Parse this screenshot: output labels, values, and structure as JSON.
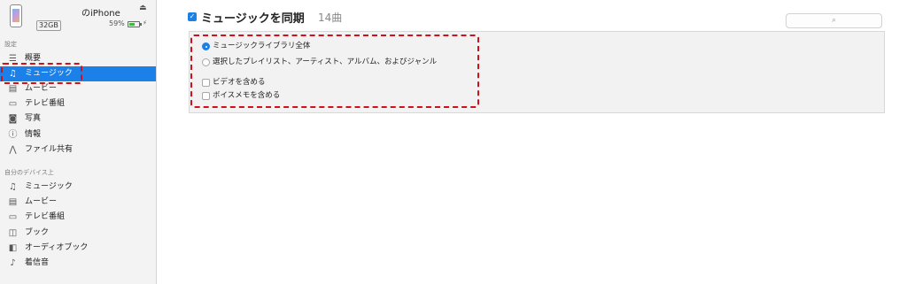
{
  "device": {
    "name": "のiPhone",
    "capacity": "32GB",
    "battery_percent": "59%",
    "battery_level": 0.59,
    "eject_icon": "eject-icon",
    "charging_icon": "charging-icon"
  },
  "sidebar": {
    "settings_label": "設定",
    "settings_items": [
      {
        "label": "概要",
        "icon": "summary-icon",
        "selected": false
      },
      {
        "label": "ミュージック",
        "icon": "music-note-icon",
        "selected": true
      },
      {
        "label": "ムービー",
        "icon": "film-icon",
        "selected": false
      },
      {
        "label": "テレビ番組",
        "icon": "tv-icon",
        "selected": false
      },
      {
        "label": "写真",
        "icon": "camera-icon",
        "selected": false
      },
      {
        "label": "情報",
        "icon": "info-icon",
        "selected": false
      },
      {
        "label": "ファイル共有",
        "icon": "file-sharing-icon",
        "selected": false
      }
    ],
    "on_device_label": "自分のデバイス上",
    "device_items": [
      {
        "label": "ミュージック",
        "icon": "music-note-icon"
      },
      {
        "label": "ムービー",
        "icon": "film-icon"
      },
      {
        "label": "テレビ番組",
        "icon": "tv-icon"
      },
      {
        "label": "ブック",
        "icon": "book-icon"
      },
      {
        "label": "オーディオブック",
        "icon": "audiobook-icon"
      },
      {
        "label": "着信音",
        "icon": "bell-icon"
      }
    ]
  },
  "main": {
    "sync_checked": true,
    "sync_title": "ミュージックを同期",
    "sync_count": "14曲",
    "search_icon": "search-icon",
    "options": [
      {
        "type": "radio",
        "label": "ミュージックライブラリ全体",
        "checked": true
      },
      {
        "type": "radio",
        "label": "選択したプレイリスト、アーティスト、アルバム、およびジャンル",
        "checked": false
      },
      {
        "type": "checkbox",
        "label": "ビデオを含める",
        "checked": false
      },
      {
        "type": "checkbox",
        "label": "ボイスメモを含める",
        "checked": false
      }
    ]
  },
  "colors": {
    "accent": "#1b81e8",
    "annotation": "#d0101a",
    "sidebar_bg": "#f3f3f3"
  }
}
